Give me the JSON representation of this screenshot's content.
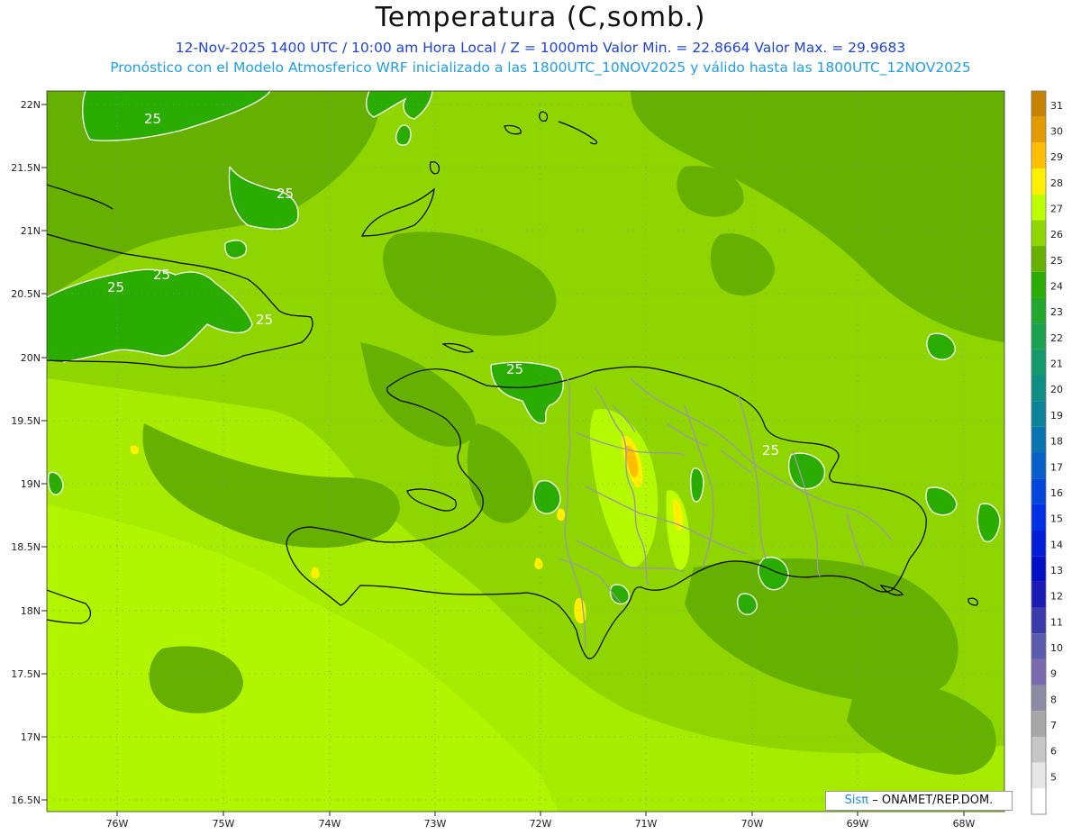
{
  "header": {
    "title": "Temperatura (C,somb.)",
    "subtitle_line1": "12-Nov-2025 1400 UTC / 10:00 am Hora Local / Z = 1000mb  Valor Min. = 22.8664  Valor Max. = 29.9683",
    "subtitle_line2": "Pronóstico con el Modelo Atmosferico WRF inicializado a las 1800UTC_10NOV2025 y válido hasta las  1800UTC_12NOV2025"
  },
  "map": {
    "lat_labels": [
      "22N",
      "21.5N",
      "21N",
      "20.5N",
      "20N",
      "19.5N",
      "19N",
      "18.5N",
      "18N",
      "17.5N",
      "17N",
      "16.5N"
    ],
    "lon_labels": [
      "76W",
      "75W",
      "74W",
      "73W",
      "72W",
      "71W",
      "70W",
      "69W",
      "68W"
    ],
    "contour_label": "25",
    "colors": {
      "land_border": "#000000",
      "province_border": "#9b9b9b",
      "contour": "#ffffff",
      "gridline": "#8080ff"
    }
  },
  "colorbar": {
    "levels": [
      {
        "label": "31",
        "color": "#c78200"
      },
      {
        "label": "30",
        "color": "#e39b00"
      },
      {
        "label": "29",
        "color": "#ffbe00"
      },
      {
        "label": "28",
        "color": "#fff000"
      },
      {
        "label": "27",
        "color": "#bbff00"
      },
      {
        "label": "26",
        "color": "#8fd600"
      },
      {
        "label": "25",
        "color": "#66b000"
      },
      {
        "label": "24",
        "color": "#2bac00"
      },
      {
        "label": "23",
        "color": "#22a82c"
      },
      {
        "label": "22",
        "color": "#1aa150"
      },
      {
        "label": "21",
        "color": "#14996c"
      },
      {
        "label": "20",
        "color": "#0f8f83"
      },
      {
        "label": "19",
        "color": "#0c8399"
      },
      {
        "label": "18",
        "color": "#0a74b0"
      },
      {
        "label": "17",
        "color": "#0760c8"
      },
      {
        "label": "16",
        "color": "#0045dc"
      },
      {
        "label": "15",
        "color": "#0030e6"
      },
      {
        "label": "14",
        "color": "#001ed6"
      },
      {
        "label": "13",
        "color": "#0010c4"
      },
      {
        "label": "12",
        "color": "#1a1ab4"
      },
      {
        "label": "11",
        "color": "#3a3aaa"
      },
      {
        "label": "10",
        "color": "#5c5cac"
      },
      {
        "label": "9",
        "color": "#7b6aae"
      },
      {
        "label": "8",
        "color": "#8b8ba4"
      },
      {
        "label": "7",
        "color": "#a7a7a7"
      },
      {
        "label": "6",
        "color": "#c6c6c6"
      },
      {
        "label": "5",
        "color": "#e6e6e6"
      },
      {
        "label": "",
        "color": "#ffffff"
      }
    ]
  },
  "credit": {
    "brand": "Sisπ",
    "text": "– ONAMET/REP.DOM."
  }
}
